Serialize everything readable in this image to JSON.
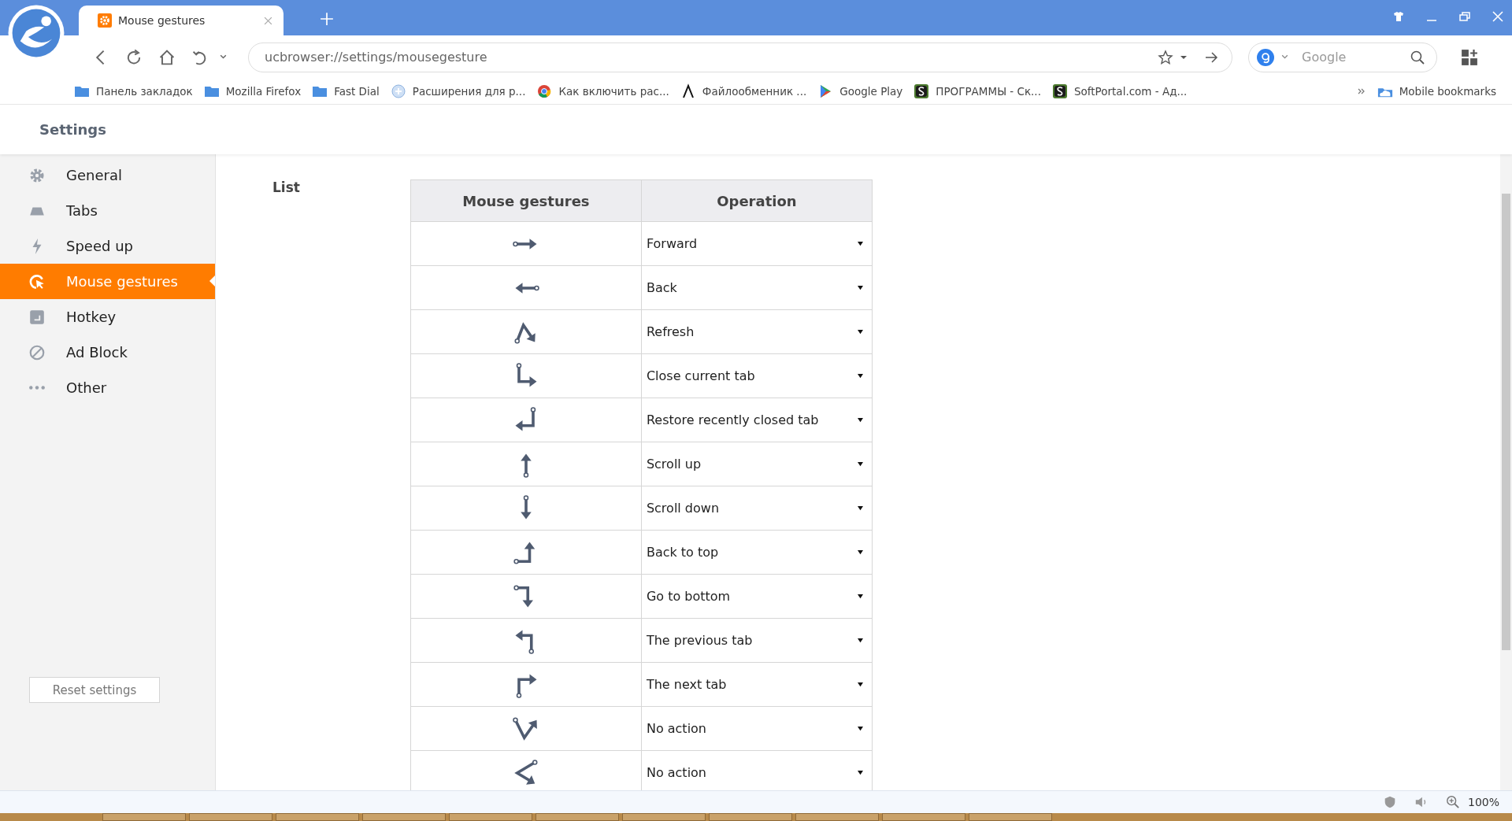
{
  "tab": {
    "title": "Mouse gestures"
  },
  "address": {
    "value": "ucbrowser://settings/mousegesture"
  },
  "search": {
    "placeholder": "Google"
  },
  "bookmarks": [
    {
      "kind": "folder",
      "label": "Панель закладок"
    },
    {
      "kind": "folder",
      "label": "Mozilla Firefox"
    },
    {
      "kind": "folder",
      "label": "Fast Dial"
    },
    {
      "kind": "extension",
      "label": "Расширения для р..."
    },
    {
      "kind": "ball",
      "label": "Как включить рас..."
    },
    {
      "kind": "lambda",
      "label": "Файлообменник ..."
    },
    {
      "kind": "play",
      "label": "Google Play"
    },
    {
      "kind": "square",
      "label": "ПРОГРАММЫ - Ск..."
    },
    {
      "kind": "square",
      "label": "SoftPortal.com - Ад..."
    }
  ],
  "mobile_bookmarks": "Mobile bookmarks",
  "settings_title": "Settings",
  "sidebar": {
    "items": [
      {
        "kind": "gear",
        "label": "General",
        "selected": false
      },
      {
        "kind": "tabs",
        "label": "Tabs",
        "selected": false
      },
      {
        "kind": "bolt",
        "label": "Speed up",
        "selected": false
      },
      {
        "kind": "cursor",
        "label": "Mouse gestures",
        "selected": true
      },
      {
        "kind": "hotkey",
        "label": "Hotkey",
        "selected": false
      },
      {
        "kind": "block",
        "label": "Ad Block",
        "selected": false
      },
      {
        "kind": "dots",
        "label": "Other",
        "selected": false
      }
    ],
    "reset_button": "Reset settings"
  },
  "section_label": "List",
  "table": {
    "columns": [
      "Mouse gestures",
      "Operation"
    ],
    "rows": [
      {
        "kind": "right",
        "operation": "Forward"
      },
      {
        "kind": "left",
        "operation": "Back"
      },
      {
        "kind": "up-down",
        "operation": "Refresh"
      },
      {
        "kind": "down-right",
        "operation": "Close current tab"
      },
      {
        "kind": "down-left",
        "operation": "Restore recently closed tab"
      },
      {
        "kind": "up",
        "operation": "Scroll up"
      },
      {
        "kind": "down",
        "operation": "Scroll down"
      },
      {
        "kind": "right-up",
        "operation": "Back to top"
      },
      {
        "kind": "right-down",
        "operation": "Go to bottom"
      },
      {
        "kind": "up-left",
        "operation": "The previous tab"
      },
      {
        "kind": "up-right",
        "operation": "The next tab"
      },
      {
        "kind": "v",
        "operation": "No action"
      },
      {
        "kind": "angle",
        "operation": "No action"
      }
    ]
  },
  "status_bar": {
    "zoom": "100%"
  }
}
